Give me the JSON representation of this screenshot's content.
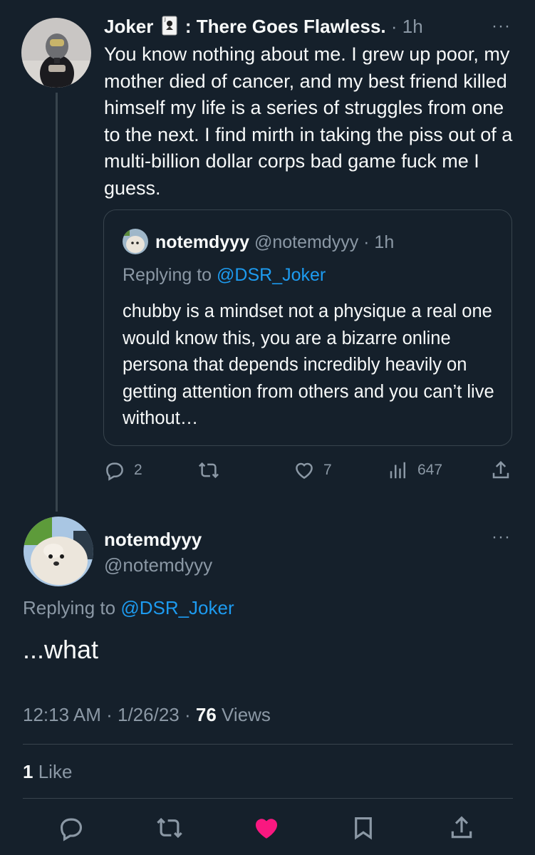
{
  "tweet1": {
    "display_name": "Joker",
    "name_suffix": ": There Goes Flawless.",
    "time": "· 1h",
    "more": "···",
    "body": "You know nothing about me. I grew up poor, my mother died of cancer, and my best friend killed himself my life is a series of struggles from one to the next. I find mirth in taking the piss out of a multi-billion dollar corps bad game fuck me I guess.",
    "quote": {
      "display_name": "notemdyyy",
      "handle": "@notemdyyy",
      "time": "· 1h",
      "replying_prefix": "Replying to",
      "replying_handle": "@DSR_Joker",
      "body": "chubby is a mindset not a physique a real one would know this, you are a bizarre online persona that depends incredibly heavily on getting attention from others and you can’t live without…"
    },
    "actions": {
      "replies": "2",
      "retweets": "",
      "likes": "7",
      "views": "647"
    }
  },
  "tweet2": {
    "display_name": "notemdyyy",
    "handle": "@notemdyyy",
    "more": "···",
    "replying_prefix": "Replying to",
    "replying_handle": "@DSR_Joker",
    "body": "...what",
    "time": "12:13 AM",
    "date": "1/26/23",
    "views_count": "76",
    "views_label": "Views",
    "likes_count": "1",
    "likes_label": "Like"
  },
  "colors": {
    "background": "#15202b",
    "text": "#f7f9f9",
    "muted": "#8b98a5",
    "link": "#1d9bf0",
    "liked": "#f91880",
    "border": "#38444d"
  },
  "icons": [
    "reply-icon",
    "retweet-icon",
    "like-icon",
    "views-icon",
    "share-icon",
    "bookmark-icon",
    "joker-card-icon",
    "more-icon"
  ]
}
